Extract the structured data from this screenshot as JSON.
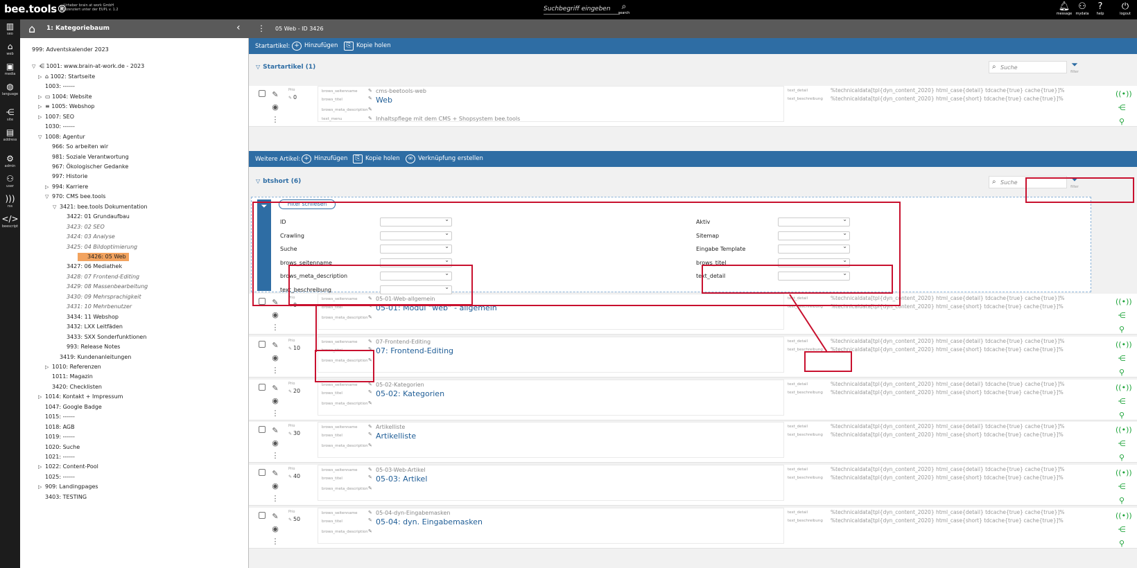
{
  "app": {
    "logo": "bee.tools®",
    "logo_sub1": "Urheber brain at work GmbH",
    "logo_sub2": "Lizenziert unter der EUPL v. 1.2",
    "search_placeholder": "Suchbegriff eingeben",
    "search_label": "search",
    "top_icons": [
      {
        "label": "message",
        "icon": "bell-icon"
      },
      {
        "label": "mydata",
        "icon": "user-icon"
      },
      {
        "label": "help",
        "icon": "help-icon"
      },
      {
        "label": "logout",
        "icon": "power-icon"
      }
    ]
  },
  "leftbar": [
    {
      "label": "seo"
    },
    {
      "label": "web"
    },
    {
      "label": "media"
    },
    {
      "label": "language"
    },
    {
      "label": "site"
    },
    {
      "label": "address"
    },
    {
      "label": "admin"
    },
    {
      "label": "user"
    },
    {
      "label": "rss"
    },
    {
      "label": "beescript"
    }
  ],
  "tree": {
    "title": "1: Kategoriebaum",
    "nodes": [
      {
        "t": "999: Adventskalender 2023",
        "d": 0,
        "tog": ""
      },
      {
        "t": "1001: www.brain-at-work.de - 2023",
        "d": 0,
        "tog": "▽",
        "icon": "⋲"
      },
      {
        "t": "1002: Startseite",
        "d": 1,
        "tog": "▷",
        "icon": "⌂"
      },
      {
        "t": "1003: ------",
        "d": 1,
        "tog": ""
      },
      {
        "t": "1004: Website",
        "d": 1,
        "tog": "▷",
        "icon": "▭"
      },
      {
        "t": "1005: Webshop",
        "d": 1,
        "tog": "▷",
        "icon": "≡"
      },
      {
        "t": "1007: SEO",
        "d": 1,
        "tog": "▷"
      },
      {
        "t": "1030: ------",
        "d": 1,
        "tog": ""
      },
      {
        "t": "1008: Agentur",
        "d": 1,
        "tog": "▽"
      },
      {
        "t": "966: So arbeiten wir",
        "d": 2,
        "tog": ""
      },
      {
        "t": "981: Soziale Verantwortung",
        "d": 2,
        "tog": ""
      },
      {
        "t": "967: Ökologischer Gedanke",
        "d": 2,
        "tog": ""
      },
      {
        "t": "997: Historie",
        "d": 2,
        "tog": ""
      },
      {
        "t": "994: Karriere",
        "d": 2,
        "tog": "▷"
      },
      {
        "t": "970: CMS bee.tools",
        "d": 2,
        "tog": "▽"
      },
      {
        "t": "3421: bee.tools Dokumentation",
        "d": 3,
        "tog": "▽"
      },
      {
        "t": "3422: 01 Grundaufbau",
        "d": 4,
        "tog": ""
      },
      {
        "t": "3423: 02 SEO",
        "d": 4,
        "tog": "",
        "it": true
      },
      {
        "t": "3424: 03 Analyse",
        "d": 4,
        "tog": "",
        "it": true
      },
      {
        "t": "3425: 04 Bildoptimierung",
        "d": 4,
        "tog": "",
        "it": true
      },
      {
        "t": "3426: 05 Web",
        "d": 4,
        "tog": "",
        "sel": true
      },
      {
        "t": "3427: 06 Mediathek",
        "d": 4,
        "tog": ""
      },
      {
        "t": "3428: 07 Frontend-Editing",
        "d": 4,
        "tog": "",
        "it": true
      },
      {
        "t": "3429: 08 Massenbearbeitung",
        "d": 4,
        "tog": "",
        "it": true
      },
      {
        "t": "3430: 09 Mehrsprachigkeit",
        "d": 4,
        "tog": "",
        "it": true
      },
      {
        "t": "3431: 10 Mehrbenutzer",
        "d": 4,
        "tog": "",
        "it": true
      },
      {
        "t": "3434: 11 Webshop",
        "d": 4,
        "tog": ""
      },
      {
        "t": "3432: LXX Leitfäden",
        "d": 4,
        "tog": ""
      },
      {
        "t": "3433: SXX Sonderfunktionen",
        "d": 4,
        "tog": ""
      },
      {
        "t": "993: Release Notes",
        "d": 4,
        "tog": ""
      },
      {
        "t": "3419: Kundenanleitungen",
        "d": 3,
        "tog": ""
      },
      {
        "t": "1010: Referenzen",
        "d": 2,
        "tog": "▷"
      },
      {
        "t": "1011: Magazin",
        "d": 2,
        "tog": ""
      },
      {
        "t": "3420: Checklisten",
        "d": 2,
        "tog": ""
      },
      {
        "t": "1014: Kontakt + Impressum",
        "d": 1,
        "tog": "▷"
      },
      {
        "t": "1047: Google Badge",
        "d": 1,
        "tog": ""
      },
      {
        "t": "1015: ------",
        "d": 1,
        "tog": ""
      },
      {
        "t": "1018: AGB",
        "d": 1,
        "tog": ""
      },
      {
        "t": "1019: ------",
        "d": 1,
        "tog": ""
      },
      {
        "t": "1020: Suche",
        "d": 1,
        "tog": ""
      },
      {
        "t": "1021: ------",
        "d": 1,
        "tog": ""
      },
      {
        "t": "1022: Content-Pool",
        "d": 1,
        "tog": "▷"
      },
      {
        "t": "1025: ------",
        "d": 1,
        "tog": ""
      },
      {
        "t": "909: Landingpages",
        "d": 1,
        "tog": "▷"
      },
      {
        "t": "3403: TESTING",
        "d": 1,
        "tog": ""
      }
    ]
  },
  "main": {
    "title": "05 Web - ID 3426",
    "startbar": {
      "label": "Startartikel:",
      "add": "Hinzufügen",
      "copy": "Kopie holen"
    },
    "start_section": {
      "title": "Startartikel (1)",
      "search": "Suche",
      "filter": "filter"
    },
    "furtherbar": {
      "label": "Weitere Artikel:",
      "add": "Hinzufügen",
      "copy": "Kopie holen",
      "link": "Verknüpfung erstellen"
    },
    "bt_section": {
      "title": "btshort (6)",
      "search": "Suche",
      "filter": "filter"
    },
    "filter": {
      "close": "Filter schließen",
      "left": [
        "ID",
        "Crawling",
        "Suche",
        "brows_seitenname",
        "brows_meta_description",
        "text_beschreibung"
      ],
      "right": [
        "Aktiv",
        "Sitemap",
        "Eingabe Template",
        "brows_titel",
        "text_detail"
      ]
    },
    "keys": {
      "seitenname": "brows_seitenname",
      "titel": "brows_titel",
      "meta": "brows_meta_description",
      "menu": "text_menu",
      "detail": "text_detail",
      "beschreibung": "text_beschreibung",
      "prio": "Prio"
    },
    "start_row": {
      "prio": "0",
      "seitenname": "cms-beetools-web",
      "titel": "Web",
      "menu": "Inhaltspflege mit dem CMS + Shopsystem bee.tools",
      "detail": "%technicaldata[tpl{dyn_content_2020} html_case{detail} tdcache{true} cache{true}]%",
      "beschreibung": "%technicaldata[tpl{dyn_content_2020} html_case{short} tdcache{true} cache{true}]%"
    },
    "rows": [
      {
        "prio": "0",
        "seitenname": "05-01-Web-allgemein",
        "titel": "05-01: Modul “web” - allgemein"
      },
      {
        "prio": "10",
        "seitenname": "07-Frontend-Editing",
        "titel": "07: Frontend-Editing"
      },
      {
        "prio": "20",
        "seitenname": "05-02-Kategorien",
        "titel": "05-02: Kategorien"
      },
      {
        "prio": "30",
        "seitenname": "Artikelliste",
        "titel": "Artikelliste"
      },
      {
        "prio": "40",
        "seitenname": "05-03-Web-Artikel",
        "titel": "05-03: Artikel"
      },
      {
        "prio": "50",
        "seitenname": "05-04-dyn-Eingabemasken",
        "titel": "05-04: dyn. Eingabemasken"
      }
    ],
    "row_detail": "%technicaldata[tpl{dyn_content_2020} html_case{detail} tdcache{true} cache{true}]%",
    "row_beschreibung": "%technicaldata[tpl{dyn_content_2020} html_case{short} tdcache{true} cache{true}]%"
  },
  "colors": {
    "accent": "#2e6da4",
    "highlight": "#c8102e",
    "selected": "#f2a35f",
    "action": "#1ea43a"
  }
}
